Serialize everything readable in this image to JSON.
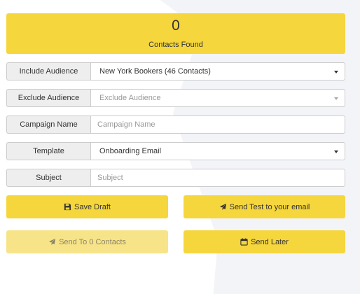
{
  "summary": {
    "count": "0",
    "label": "Contacts Found"
  },
  "form": {
    "include": {
      "label": "Include Audience",
      "value": "New York Bookers (46 Contacts)"
    },
    "exclude": {
      "label": "Exclude Audience",
      "placeholder": "Exclude Audience"
    },
    "campaign": {
      "label": "Campaign Name",
      "placeholder": "Campaign Name"
    },
    "template": {
      "label": "Template",
      "value": "Onboarding Email"
    },
    "subject": {
      "label": "Subject",
      "placeholder": "Subject"
    }
  },
  "buttons": {
    "save_draft": "Save Draft",
    "send_test": "Send Test to your email",
    "send_to": "Send To 0 Contacts",
    "send_later": "Send Later"
  },
  "icons": {
    "save": "floppy-disk-icon",
    "send": "paper-plane-icon",
    "calendar": "calendar-icon"
  },
  "colors": {
    "accent": "#f5d63d",
    "accent_disabled": "#f7e488",
    "addon_bg": "#eeeeee"
  }
}
